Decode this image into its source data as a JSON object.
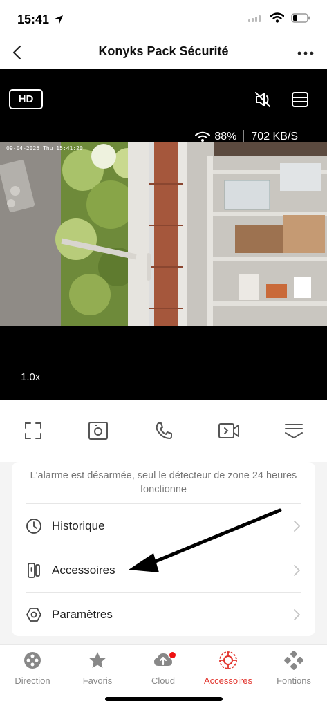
{
  "status_bar": {
    "time": "15:41"
  },
  "header": {
    "title": "Konyks Pack Sécurité"
  },
  "video": {
    "hd_label": "HD",
    "wifi_signal": "88%",
    "bitrate": "702 KB/S",
    "timestamp": "09-04-2025 Thu 15:41:20",
    "zoom": "1.0x"
  },
  "controls": {
    "icons": [
      "fullscreen-icon",
      "snapshot-icon",
      "call-icon",
      "record-icon",
      "collapse-icon"
    ]
  },
  "card": {
    "alarm_message": "L'alarme est désarmée, seul le détecteur de zone 24 heures fonctionne",
    "items": [
      {
        "label": "Historique",
        "icon": "clock-icon"
      },
      {
        "label": "Accessoires",
        "icon": "sensor-icon"
      },
      {
        "label": "Paramètres",
        "icon": "settings-icon"
      }
    ]
  },
  "bottom_nav": {
    "items": [
      {
        "label": "Direction",
        "icon": "direction-icon"
      },
      {
        "label": "Favoris",
        "icon": "star-icon"
      },
      {
        "label": "Cloud",
        "icon": "cloud-icon"
      },
      {
        "label": "Accessoires",
        "icon": "accessories-icon"
      },
      {
        "label": "Fontions",
        "icon": "functions-icon"
      }
    ],
    "active_index": 3
  },
  "colors": {
    "accent": "#e2352e",
    "badge": "#ee1111"
  }
}
